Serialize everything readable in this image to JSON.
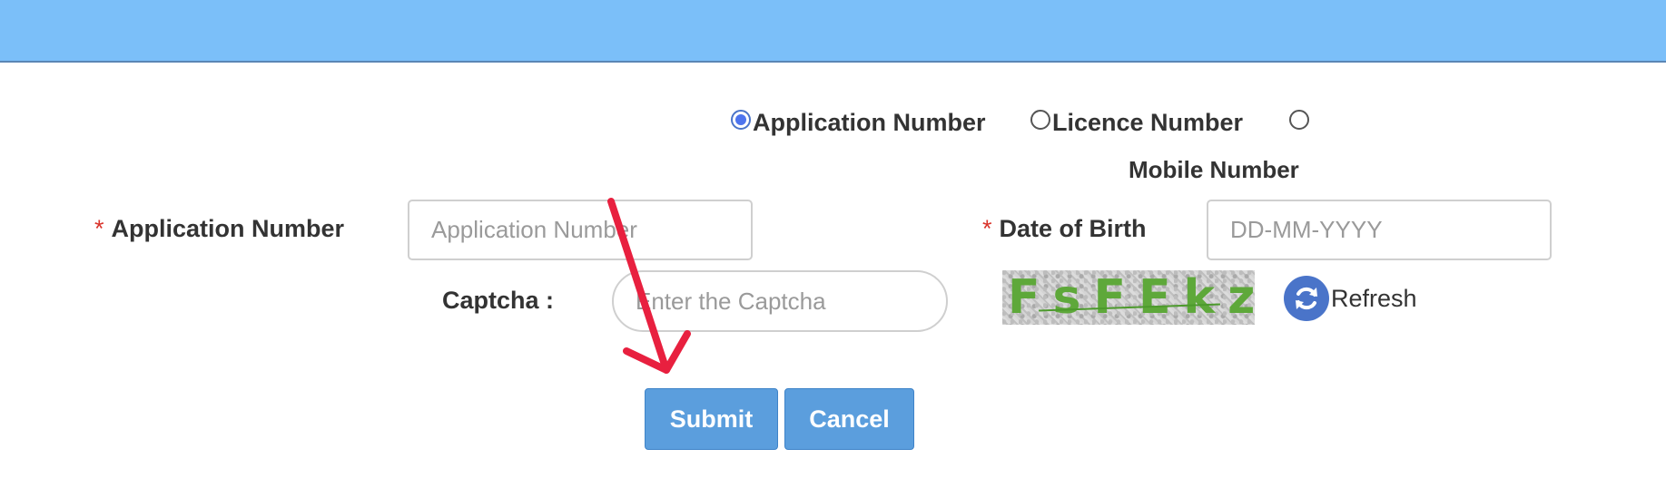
{
  "search_by": {
    "options": [
      {
        "label": "Application Number",
        "checked": true
      },
      {
        "label": "Licence Number",
        "checked": false
      },
      {
        "label": "Mobile Number",
        "checked": false
      }
    ]
  },
  "form": {
    "application_number": {
      "required_marker": "*",
      "label": "Application Number",
      "placeholder": "Application Number",
      "value": ""
    },
    "date_of_birth": {
      "required_marker": "*",
      "label": "Date of Birth",
      "placeholder": "DD-MM-YYYY",
      "value": ""
    },
    "captcha": {
      "label": "Captcha :",
      "placeholder": "Enter the Captcha",
      "value": "",
      "image_text": "FsFEkz"
    },
    "refresh_label": "Refresh"
  },
  "actions": {
    "submit_label": "Submit",
    "cancel_label": "Cancel"
  },
  "icons": {
    "refresh": "refresh-icon",
    "annotation": "red-arrow-icon"
  },
  "colors": {
    "header_bar": "#7bbff9",
    "button": "#5b9edd",
    "radio_selected": "#4d74ee",
    "required_marker": "#d9342b",
    "annotation_arrow": "#e8203f",
    "captcha_text": "#5ea83a"
  }
}
